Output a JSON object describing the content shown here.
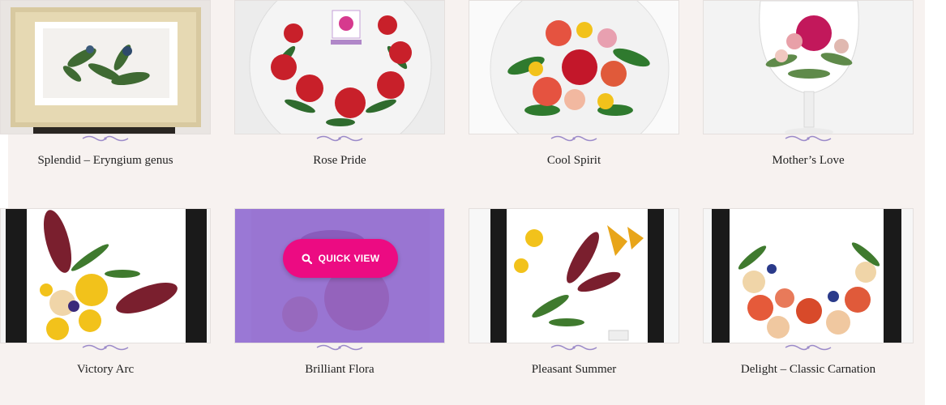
{
  "products": [
    {
      "name": "Splendid – Eryngium genus"
    },
    {
      "name": "Rose Pride"
    },
    {
      "name": "Cool Spirit"
    },
    {
      "name": "Mother’s Love"
    },
    {
      "name": "Victory Arc"
    },
    {
      "name": "Brilliant Flora"
    },
    {
      "name": "Pleasant Summer"
    },
    {
      "name": "Delight – Classic Carnation"
    }
  ],
  "quick_view": {
    "label": "QUICK VIEW",
    "icon": "search-icon"
  },
  "colors": {
    "background": "#f7f2f0",
    "accent": "#ec0b82",
    "overlay": "#8c64d2",
    "ornament": "#9b8ac9"
  }
}
